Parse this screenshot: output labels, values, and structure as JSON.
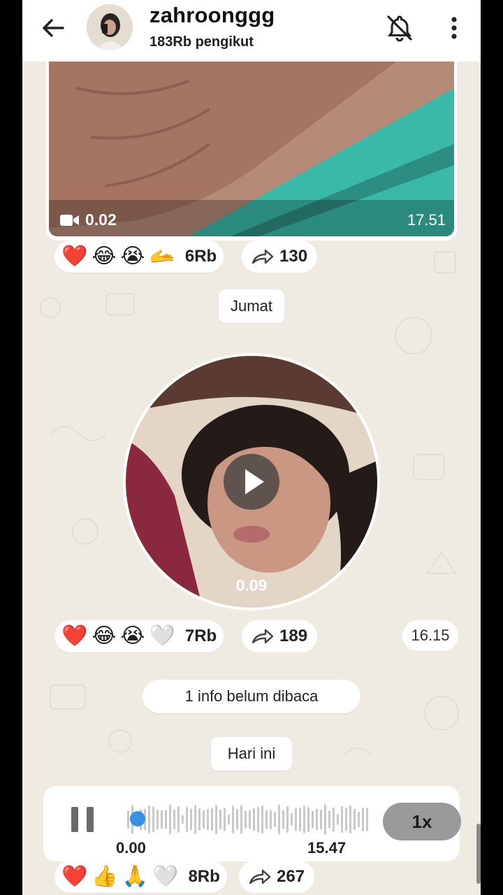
{
  "header": {
    "channel_name": "zahroonggg",
    "followers": "183Rb pengikut",
    "icons": [
      "back-arrow-icon",
      "avatar",
      "bell-off-icon",
      "more-vertical-icon"
    ]
  },
  "video_message": {
    "duration": "0.02",
    "time": "17.51",
    "reactions": [
      "❤️",
      "😂",
      "😭",
      "🫴"
    ],
    "reaction_count": "6Rb",
    "forward_count": "130"
  },
  "date_jumat": "Jumat",
  "round_video": {
    "duration": "0.09",
    "reactions": [
      "❤️",
      "😂",
      "😭",
      "🤍"
    ],
    "reaction_count": "7Rb",
    "forward_count": "189",
    "time": "16.15"
  },
  "unread_notice": "1 info belum dibaca",
  "date_today": "Hari ini",
  "audio_message": {
    "elapsed": "0.00",
    "time": "15.47",
    "speed": "1x",
    "reactions": [
      "❤️",
      "👍",
      "🙏",
      "🤍"
    ],
    "reaction_count": "8Rb",
    "forward_count": "267"
  },
  "colors": {
    "header_bg": "#ffffff",
    "chat_bg": "#efeae2",
    "accent_blue": "#3a8fe8",
    "bubble": "#ffffff"
  }
}
